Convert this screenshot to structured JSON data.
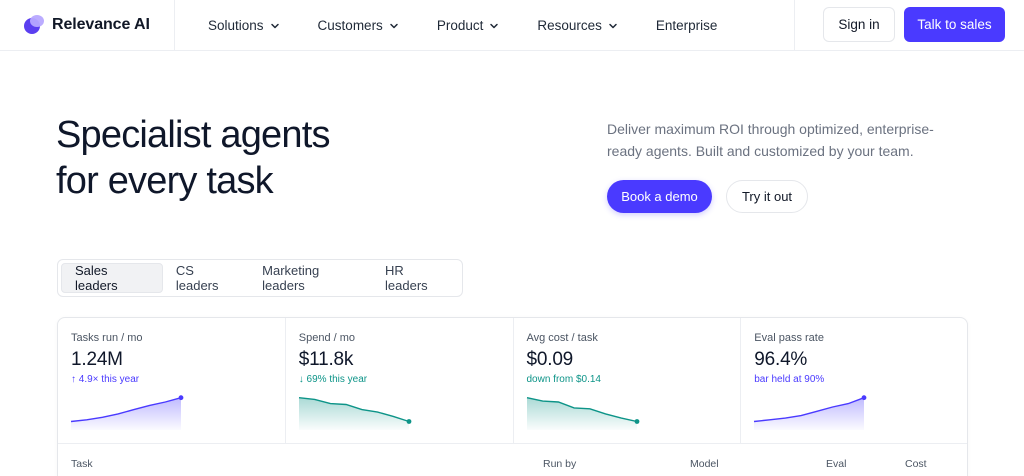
{
  "brand": {
    "name": "Relevance AI"
  },
  "nav": {
    "items": [
      {
        "label": "Solutions",
        "dropdown": true
      },
      {
        "label": "Customers",
        "dropdown": true
      },
      {
        "label": "Product",
        "dropdown": true
      },
      {
        "label": "Resources",
        "dropdown": true
      },
      {
        "label": "Enterprise",
        "dropdown": false
      }
    ],
    "sign_in": "Sign in",
    "talk_to_sales": "Talk to sales"
  },
  "hero": {
    "title_line1": "Specialist agents",
    "title_line2": "for every task",
    "description": "Deliver maximum ROI through optimized, enterprise-ready agents. Built and customized by your team.",
    "book_demo": "Book a demo",
    "try_it_out": "Try it out"
  },
  "tabs": [
    {
      "label": "Sales leaders",
      "active": true
    },
    {
      "label": "CS leaders",
      "active": false
    },
    {
      "label": "Marketing leaders",
      "active": false
    },
    {
      "label": "HR leaders",
      "active": false
    }
  ],
  "metrics": [
    {
      "label": "Tasks run / mo",
      "value": "1.24M",
      "sub": "↑ 4.9× this year",
      "trend": "up",
      "spark": [
        10,
        12,
        15,
        19,
        24,
        29,
        33,
        38
      ]
    },
    {
      "label": "Spend / mo",
      "value": "$11.8k",
      "sub": "↓ 69% this year",
      "trend": "down",
      "spark": [
        38,
        36,
        31,
        30,
        24,
        21,
        16,
        10
      ]
    },
    {
      "label": "Avg cost / task",
      "value": "$0.09",
      "sub": "down from $0.14",
      "trend": "down",
      "spark": [
        38,
        34,
        33,
        26,
        25,
        19,
        14,
        10
      ]
    },
    {
      "label": "Eval pass rate",
      "value": "96.4%",
      "sub": "bar held at 90%",
      "trend": "up",
      "spark": [
        10,
        12,
        14,
        17,
        22,
        27,
        31,
        38
      ]
    }
  ],
  "table": {
    "headers": [
      "Task",
      "Run by",
      "Model",
      "Eval",
      "Cost"
    ]
  },
  "colors": {
    "accent": "#4a3aff",
    "teal": "#0d9488"
  }
}
